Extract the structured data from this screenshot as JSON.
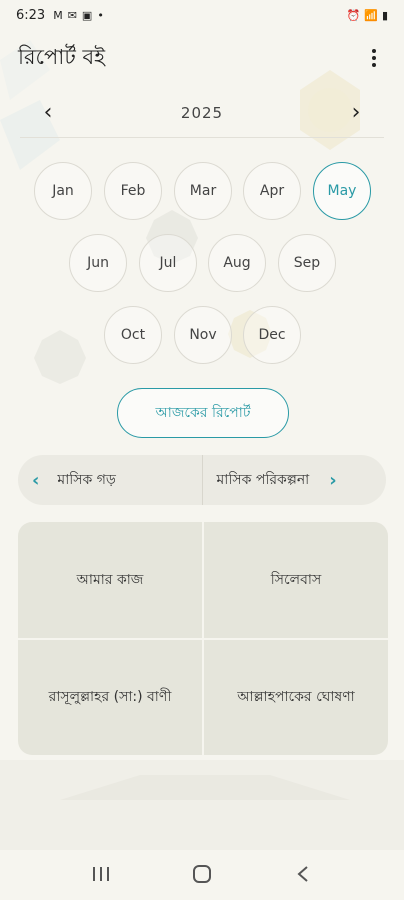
{
  "status": {
    "time": "6:23",
    "left_icons": [
      "M",
      "✉",
      "▣",
      "•"
    ],
    "right_icons": [
      "⏰",
      "📶",
      "▮"
    ]
  },
  "app": {
    "title": "রিপোর্ট বই",
    "menu_icon": "more-vert-icon"
  },
  "calendar": {
    "year": "2025",
    "months": [
      "Jan",
      "Feb",
      "Mar",
      "Apr",
      "May",
      "Jun",
      "Jul",
      "Aug",
      "Sep",
      "Oct",
      "Nov",
      "Dec"
    ],
    "selected_month": "May"
  },
  "today_button": "আজকের রিপোর্ট",
  "tabs": {
    "left": "মাসিক গড়",
    "right": "মাসিক পরিকল্পনা"
  },
  "grid": {
    "items": [
      "আমার কাজ",
      "সিলেবাস",
      "রাসূলুল্লাহর (সা:) বাণী",
      "আল্লাহপাকের ঘোষণা"
    ]
  },
  "colors": {
    "accent": "#2a9aa6",
    "background": "#f6f5ef",
    "card": "#e3e2d8"
  }
}
